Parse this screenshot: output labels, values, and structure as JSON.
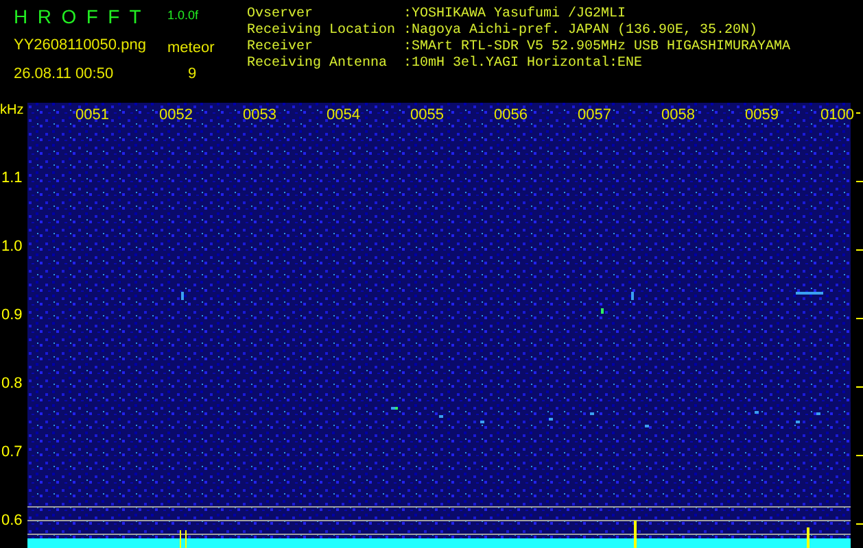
{
  "header": {
    "app_title": "H R O F F T",
    "version": "1.0.0f",
    "file_name": "YY2608110050.png",
    "date_time": "26.08.11 00:50",
    "mode_label": "meteor",
    "count": "9"
  },
  "station_info": [
    {
      "label": "Ovserver",
      "value": ":YOSHIKAWA Yasufumi /JG2MLI"
    },
    {
      "label": "Receiving Location",
      "value": ":Nagoya Aichi-pref. JAPAN (136.90E, 35.20N)"
    },
    {
      "label": "Receiver",
      "value": ":SMArt RTL-SDR V5 52.905MHz USB HIGASHIMURAYAMA"
    },
    {
      "label": "Receiving Antenna",
      "value": ":10mH 3el.YAGI Horizontal:ENE"
    }
  ],
  "y_axis": {
    "unit": "kHz",
    "labels": [
      "1.1",
      "1.0",
      "0.9",
      "0.8",
      "0.7",
      "0.6"
    ]
  },
  "time_labels": [
    "0051",
    "0052",
    "0053",
    "0054",
    "0055",
    "0056",
    "0057",
    "0058",
    "0059",
    "0100"
  ]
}
